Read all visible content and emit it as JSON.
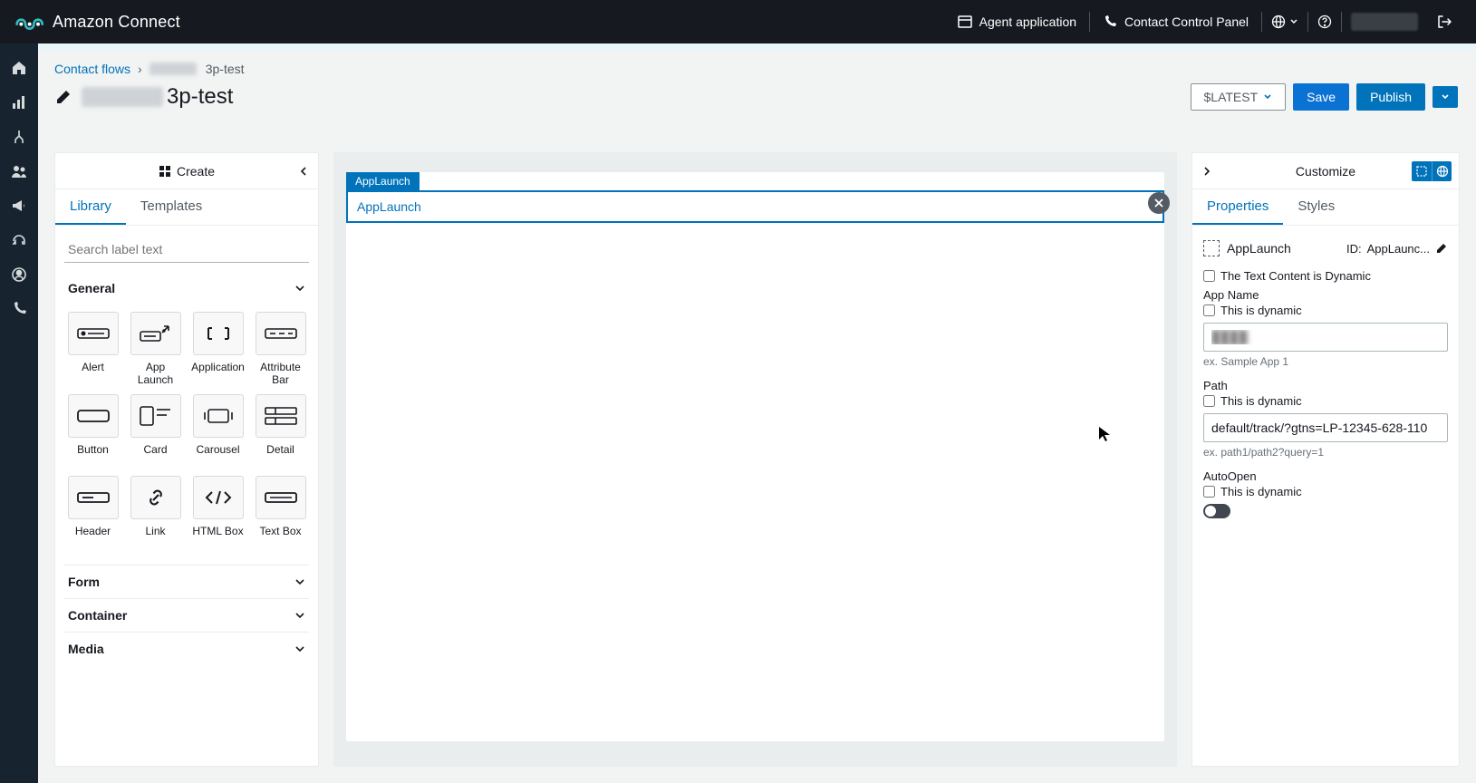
{
  "topbar": {
    "brand": "Amazon Connect",
    "agent_app": "Agent application",
    "ccp": "Contact Control Panel"
  },
  "breadcrumb": {
    "root": "Contact flows",
    "current_suffix": "3p-test"
  },
  "title": {
    "suffix": "3p-test"
  },
  "title_actions": {
    "latest": "$LATEST",
    "save": "Save",
    "publish": "Publish"
  },
  "create": {
    "header": "Create",
    "tabs": {
      "library": "Library",
      "templates": "Templates"
    },
    "search_placeholder": "Search label text",
    "sections": {
      "general": "General",
      "form": "Form",
      "container": "Container",
      "media": "Media"
    },
    "blocks": [
      "Alert",
      "App Launch",
      "Application",
      "Attribute Bar",
      "Button",
      "Card",
      "Carousel",
      "Detail",
      "Header",
      "Link",
      "HTML Box",
      "Text Box"
    ]
  },
  "canvas": {
    "node_chip": "AppLaunch",
    "node_body": "AppLaunch"
  },
  "customize": {
    "header": "Customize",
    "tabs": {
      "properties": "Properties",
      "styles": "Styles"
    },
    "element_name": "AppLaunch",
    "id_label": "ID:",
    "id_value": "AppLaunc...",
    "dynamic_text_label": "The Text Content is Dynamic",
    "app_name": {
      "label": "App Name",
      "dynamic": "This is dynamic",
      "value": "",
      "hint": "ex. Sample App 1"
    },
    "path": {
      "label": "Path",
      "dynamic": "This is dynamic",
      "value": "default/track/?gtns=LP-12345-628-110",
      "hint": "ex. path1/path2?query=1"
    },
    "autoopen": {
      "label": "AutoOpen",
      "dynamic": "This is dynamic"
    }
  }
}
